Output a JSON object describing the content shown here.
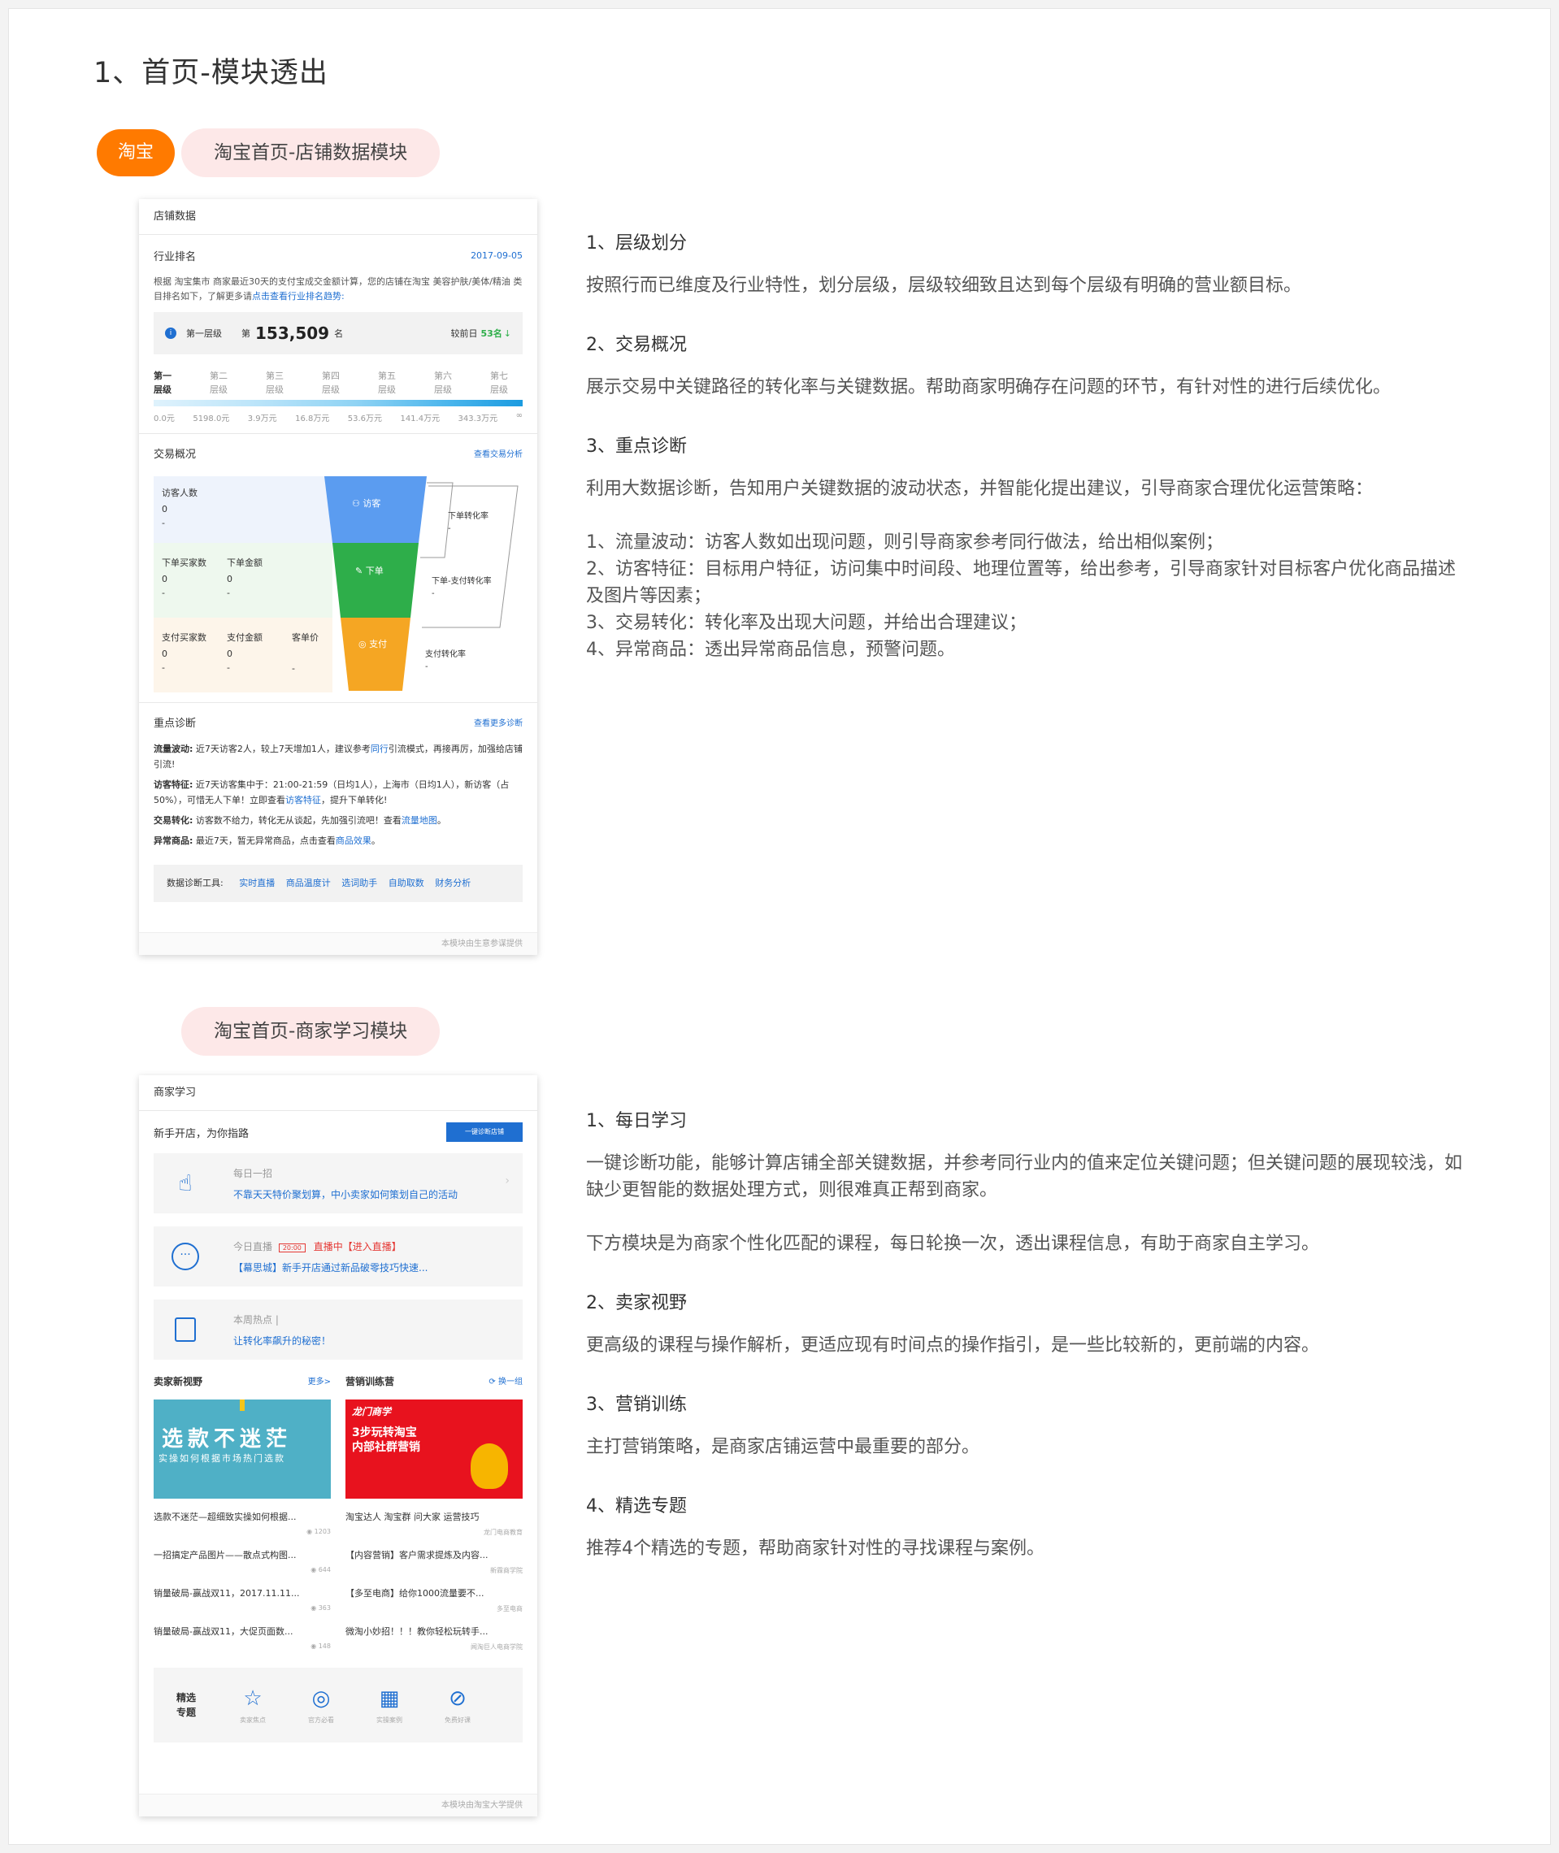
{
  "page": {
    "title": "1、首页-模块透出"
  },
  "tags": {
    "platform": "淘宝",
    "module1": "淘宝首页-店铺数据模块",
    "module2": "淘宝首页-商家学习模块"
  },
  "store_panel": {
    "header": "店铺数据",
    "industry": {
      "title": "行业排名",
      "date": "2017-09-05",
      "desc": "根据 淘宝集市 商家最近30天的支付宝成交金额计算，您的店铺在淘宝 美容护肤/美体/精油 类目排名如下，了解更多请",
      "link": "点击查看行业排名趋势:",
      "level_label": "第一层级",
      "rank_prefix": "第",
      "rank_value": "153,509",
      "rank_suffix": "名",
      "compare_label": "较前日",
      "compare_value": "53名",
      "levels": [
        {
          "a": "第一",
          "b": "层级"
        },
        {
          "a": "第二",
          "b": "层级"
        },
        {
          "a": "第三",
          "b": "层级"
        },
        {
          "a": "第四",
          "b": "层级"
        },
        {
          "a": "第五",
          "b": "层级"
        },
        {
          "a": "第六",
          "b": "层级"
        },
        {
          "a": "第七",
          "b": "层级"
        }
      ],
      "ticks": [
        "0.0元",
        "5198.0元",
        "3.9万元",
        "16.8万元",
        "53.6万元",
        "141.4万元",
        "343.3万元",
        "∞"
      ]
    },
    "trade": {
      "title": "交易概况",
      "link": "查看交易分析",
      "visitors_label": "访客人数",
      "visitors_value": "0",
      "visitors_sub": "-",
      "order_buyers_label": "下单买家数",
      "order_buyers_value": "0",
      "order_buyers_sub": "-",
      "order_amount_label": "下单金额",
      "order_amount_value": "0",
      "order_amount_sub": "-",
      "pay_buyers_label": "支付买家数",
      "pay_buyers_value": "0",
      "pay_buyers_sub": "-",
      "pay_amount_label": "支付金额",
      "pay_amount_value": "0",
      "pay_amount_sub": "-",
      "unit_price_label": "客单价",
      "unit_price_sub": "-",
      "funnel_visit": "访客",
      "funnel_order": "下单",
      "funnel_pay": "支付",
      "rate_order": "下单转化率",
      "rate_order_val": "-",
      "rate_order_pay": "下单-支付转化率",
      "rate_order_pay_val": "-",
      "rate_pay": "支付转化率",
      "rate_pay_val": "-"
    },
    "diagnosis": {
      "title": "重点诊断",
      "link": "查看更多诊断",
      "items": [
        {
          "k": "流量波动:",
          "pre": "近7天访客2人，较上7天增加1人，建议参考",
          "lk": "同行",
          "post": "引流模式，再接再厉，加强给店铺引流!"
        },
        {
          "k": "访客特征:",
          "pre": "近7天访客集中于：21:00-21:59（日均1人），上海市（日均1人），新访客（占50%），可惜无人下单！立即查看",
          "lk": "访客特征",
          "post": "，提升下单转化!"
        },
        {
          "k": "交易转化:",
          "pre": "访客数不给力，转化无从谈起，先加强引流吧！查看",
          "lk": "流量地图",
          "post": "。"
        },
        {
          "k": "异常商品:",
          "pre": "最近7天，暂无异常商品，点击查看",
          "lk": "商品效果",
          "post": "。"
        }
      ],
      "tools_label": "数据诊断工具:",
      "tools": [
        "实时直播",
        "商品温度计",
        "选词助手",
        "自助取数",
        "财务分析"
      ]
    },
    "footer": "本模块由生意参谋提供"
  },
  "store_desc": [
    {
      "h": "1、层级划分",
      "p": [
        "按照行而已维度及行业特性，划分层级，层级较细致且达到每个层级有明确的营业额目标。"
      ]
    },
    {
      "h": "2、交易概况",
      "p": [
        "展示交易中关键路径的转化率与关键数据。帮助商家明确存在问题的环节，有针对性的进行后续优化。"
      ]
    },
    {
      "h": "3、重点诊断",
      "p": [
        "利用大数据诊断，告知用户关键数据的波动状态，并智能化提出建议，引导商家合理优化运营策略：",
        "",
        "1、流量波动：访客人数如出现问题，则引导商家参考同行做法，给出相似案例；",
        "2、访客特征：目标用户特征，访问集中时间段、地理位置等，给出参考，引导商家针对目标客户优化商品描述及图片等因素；",
        "3、交易转化：转化率及出现大问题，并给出合理建议；",
        "4、异常商品：透出异常商品信息，预警问题。"
      ]
    }
  ],
  "learn_panel": {
    "header": "商家学习",
    "guide_title": "新手开店，为你指路",
    "guide_button": "一键诊断店铺",
    "cards": [
      {
        "t1": "每日一招",
        "t2": "不靠天天特价聚划算，中小卖家如何策划自己的活动"
      },
      {
        "t1": "今日直播",
        "badge": "20:00",
        "live": "直播中【进入直播】",
        "t2": "【幕思城】新手开店通过新品破零技巧快速..."
      },
      {
        "t1": "本周热点 |",
        "t2": "让转化率飙升的秘密！"
      }
    ],
    "left_section": "卖家新视野",
    "left_more": "更多>",
    "right_section": "营销训练营",
    "right_more": "换一组",
    "banner_left_title": "选款不迷茫",
    "banner_left_sub": "实操如何根据市场热门选款",
    "banner_right_logo": "龙门商学",
    "banner_right_l1": "3步玩转淘宝",
    "banner_right_l2": "内部社群营销",
    "rows": [
      {
        "l": "选款不迷茫—超细致实操如何根据...",
        "lm": "1203",
        "r": "淘宝达人 淘宝群 问大家 运营技巧",
        "rm": "龙门电商教育"
      },
      {
        "l": "一招搞定产品图片——散点式构图...",
        "lm": "644",
        "r": "【内容营销】客户需求提炼及内容...",
        "rm": "新霖商学院"
      },
      {
        "l": "销量破局-赢战双11，2017.11.11...",
        "lm": "363",
        "r": "【多至电商】给你1000流量要不...",
        "rm": "多至电商"
      },
      {
        "l": "销量破局-赢战双11，大促页面数...",
        "lm": "148",
        "r": "微淘小妙招！！！教你轻松玩转手...",
        "rm": "闻淘巨人电商学院"
      }
    ],
    "featured_label_1": "精选",
    "featured_label_2": "专题",
    "featured": [
      "卖家焦点",
      "官方必看",
      "实操案例",
      "免费好课"
    ],
    "footer": "本模块由淘宝大学提供"
  },
  "learn_desc": [
    {
      "h": "1、每日学习",
      "p": [
        "一键诊断功能，能够计算店铺全部关键数据，并参考同行业内的值来定位关键问题；但关键问题的展现较浅，如缺少更智能的数据处理方式，则很难真正帮到商家。",
        "",
        "下方模块是为商家个性化匹配的课程，每日轮换一次，透出课程信息，有助于商家自主学习。"
      ]
    },
    {
      "h": "2、卖家视野",
      "p": [
        "更高级的课程与操作解析，更适应现有时间点的操作指引，是一些比较新的，更前端的内容。"
      ]
    },
    {
      "h": "3、营销训练",
      "p": [
        "主打营销策略，是商家店铺运营中最重要的部分。"
      ]
    },
    {
      "h": "4、精选专题",
      "p": [
        "推荐4个精选的专题，帮助商家针对性的寻找课程与案例。"
      ]
    }
  ],
  "colors": {
    "orange": "#ff7a00",
    "pink": "#fde8e8",
    "blue": "#1f6fd1",
    "funnel_blue": "#5b9cf0",
    "funnel_green": "#2eae4a",
    "funnel_orange": "#f5a623"
  }
}
